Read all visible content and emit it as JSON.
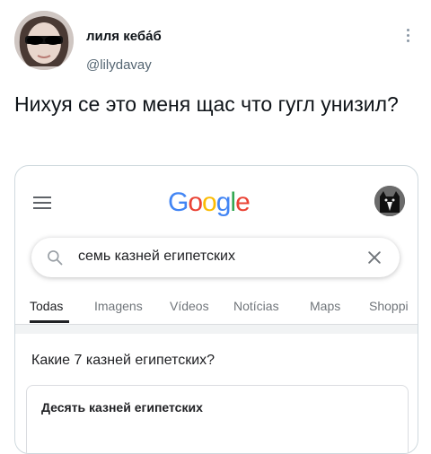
{
  "tweet": {
    "author_name": "лиля кеба́б",
    "author_handle": "@lilydavay",
    "text": "Нихуя се это меня щас что гугл унизил?"
  },
  "embed": {
    "logo": [
      "G",
      "o",
      "o",
      "g",
      "l",
      "e"
    ],
    "logo_colors": [
      "#4285F4",
      "#EA4335",
      "#FBBC05",
      "#4285F4",
      "#34A853",
      "#EA4335"
    ],
    "search": {
      "query": "семь казней египетских"
    },
    "tabs": [
      "Todas",
      "Imagens",
      "Vídeos",
      "Notícias",
      "Maps",
      "Shoppi"
    ],
    "question": "Какие 7 казней египетских?",
    "answer_title": "Десять казней египетских"
  }
}
